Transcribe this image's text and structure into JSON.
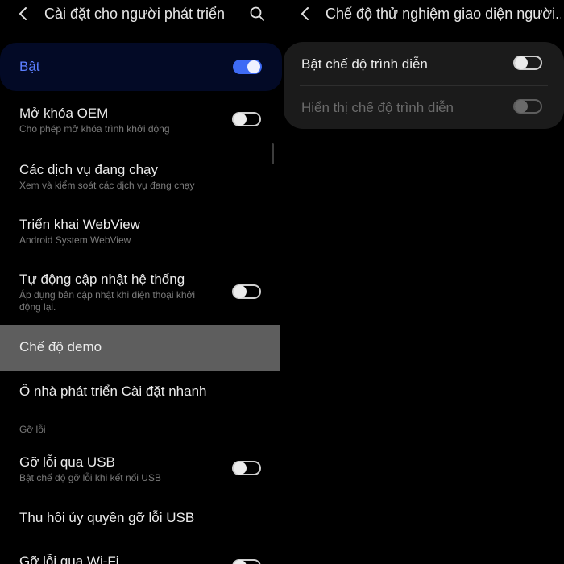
{
  "left": {
    "header": {
      "title": "Cài đặt cho người phát triển",
      "back_icon": "chevron-left-icon",
      "search_icon": "search-icon"
    },
    "master": {
      "label": "Bật",
      "toggle": "on",
      "accent": "#3e6bf5"
    },
    "items": [
      {
        "title": "Mở khóa OEM",
        "subtitle": "Cho phép mở khóa trình khởi động",
        "toggle": "off"
      },
      {
        "title": "Các dịch vụ đang chạy",
        "subtitle": "Xem và kiểm soát các dịch vụ đang chạy"
      },
      {
        "title": "Triển khai WebView",
        "subtitle": "Android System WebView"
      },
      {
        "title": "Tự động cập nhật hệ thống",
        "subtitle_line1": "Áp dụng bản cập nhật khi điện thoại khởi",
        "subtitle_line2": "động lại.",
        "toggle": "off"
      },
      {
        "title": "Chế độ demo",
        "highlighted": true
      },
      {
        "title": "Ô nhà phát triển Cài đặt nhanh"
      },
      {
        "section": "Gỡ lỗi"
      },
      {
        "title": "Gỡ lỗi qua USB",
        "subtitle": "Bật chế độ gỡ lỗi khi kết nối USB",
        "toggle": "off"
      },
      {
        "title": "Thu hồi ủy quyền gỡ lỗi USB"
      },
      {
        "title": "Gỡ lỗi qua Wi-Fi",
        "toggle": "off"
      }
    ]
  },
  "right": {
    "header": {
      "title": "Chế độ thử nghiệm giao diện người...",
      "back_icon": "chevron-left-icon"
    },
    "options": [
      {
        "label": "Bật chế độ trình diễn",
        "toggle": "off",
        "enabled": true
      },
      {
        "label": "Hiển thị chế độ trình diễn",
        "toggle": "off",
        "enabled": false
      }
    ]
  }
}
